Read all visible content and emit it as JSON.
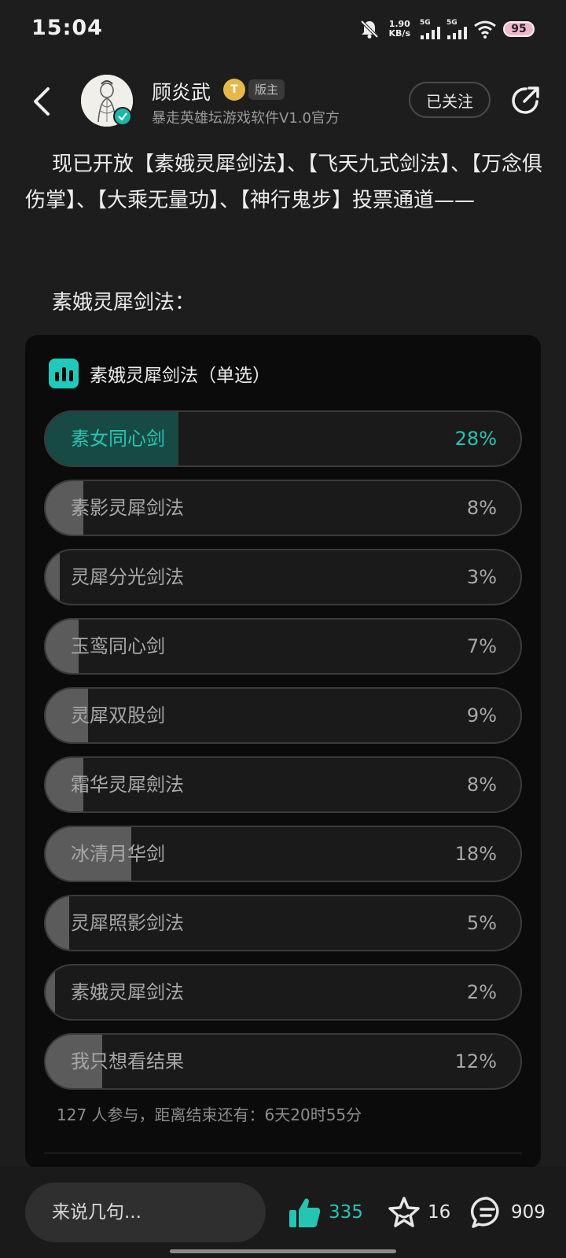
{
  "status_bar": {
    "time": "15:04",
    "net_speed_value": "1.90",
    "net_speed_unit": "KB/s",
    "sim1_label": "5G",
    "sim2_label": "5G",
    "battery": "95",
    "icons": [
      "bell-muted-icon",
      "signal-icon",
      "wifi-icon",
      "battery-icon"
    ]
  },
  "header": {
    "author_name": "顾炎武",
    "level_badge": "T",
    "role_badge": "版主",
    "author_sub": "暴走英雄坛游戏软件V1.0官方",
    "follow_label": "已关注"
  },
  "post": {
    "intro": "现已开放【素娥灵犀剑法】、【飞天九式剑法】、【万念俱伤掌】、【大乘无量功】、【神行鬼步】投票通道——",
    "section_title": "素娥灵犀剑法："
  },
  "poll": {
    "title": "素娥灵犀剑法（单选）",
    "options": [
      {
        "label": "素女同心剑",
        "pct_text": "28%",
        "fraction": 0.28,
        "selected": true
      },
      {
        "label": "素影灵犀剑法",
        "pct_text": "8%",
        "fraction": 0.08,
        "selected": false
      },
      {
        "label": "灵犀分光剑法",
        "pct_text": "3%",
        "fraction": 0.03,
        "selected": false
      },
      {
        "label": "玉鸾同心剑",
        "pct_text": "7%",
        "fraction": 0.07,
        "selected": false
      },
      {
        "label": "灵犀双股剑",
        "pct_text": "9%",
        "fraction": 0.09,
        "selected": false
      },
      {
        "label": "霜华灵犀劍法",
        "pct_text": "8%",
        "fraction": 0.08,
        "selected": false
      },
      {
        "label": "冰清月华剑",
        "pct_text": "18%",
        "fraction": 0.18,
        "selected": false
      },
      {
        "label": "灵犀照影剑法",
        "pct_text": "5%",
        "fraction": 0.05,
        "selected": false
      },
      {
        "label": "素娥灵犀剑法",
        "pct_text": "2%",
        "fraction": 0.02,
        "selected": false
      },
      {
        "label": "我只想看结果",
        "pct_text": "12%",
        "fraction": 0.12,
        "selected": false
      }
    ],
    "footer": "127 人参与，距离结束还有：6天20时55分"
  },
  "bottom_bar": {
    "comment_placeholder": "来说几句...",
    "like_count": "335",
    "fav_count": "16",
    "comment_count": "909"
  },
  "colors": {
    "accent": "#27c4b3",
    "background": "#1d1d1d",
    "card": "#0b0b0b"
  }
}
